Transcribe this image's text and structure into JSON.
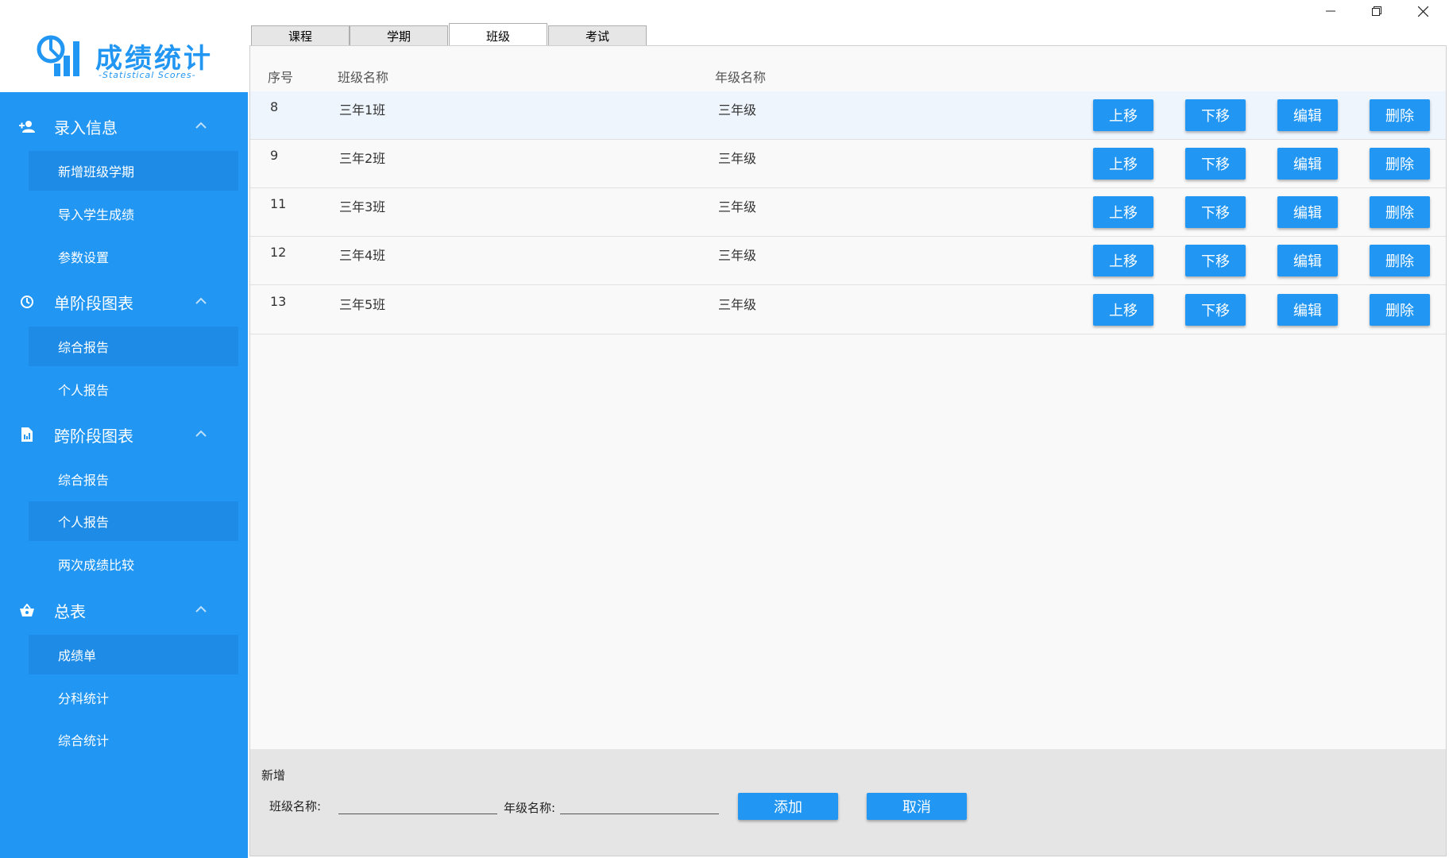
{
  "brand": {
    "title": "成绩统计",
    "subtitle": "-Statistical Scores-",
    "accent_color": "#2196f3"
  },
  "window": {
    "minimize_icon": "minimize-icon",
    "maximize_icon": "restore-icon",
    "close_icon": "close-icon"
  },
  "sidebar": {
    "sections": [
      {
        "label": "录入信息",
        "icon": "person-add-icon",
        "items": [
          "新增班级学期",
          "导入学生成绩",
          "参数设置"
        ]
      },
      {
        "label": "单阶段图表",
        "icon": "clock-icon",
        "items": [
          "综合报告",
          "个人报告"
        ]
      },
      {
        "label": "跨阶段图表",
        "icon": "document-icon",
        "items": [
          "综合报告",
          "个人报告",
          "两次成绩比较"
        ]
      },
      {
        "label": "总表",
        "icon": "basket-icon",
        "items": [
          "成绩单",
          "分科统计",
          "综合统计"
        ]
      }
    ]
  },
  "tabs": [
    "课程",
    "学期",
    "班级",
    "考试"
  ],
  "active_tab": "班级",
  "table": {
    "headers": [
      "序号",
      "班级名称",
      "年级名称"
    ],
    "rows": [
      {
        "id": "8",
        "class_name": "三年1班",
        "grade_name": "三年级"
      },
      {
        "id": "9",
        "class_name": "三年2班",
        "grade_name": "三年级"
      },
      {
        "id": "11",
        "class_name": "三年3班",
        "grade_name": "三年级"
      },
      {
        "id": "12",
        "class_name": "三年4班",
        "grade_name": "三年级"
      },
      {
        "id": "13",
        "class_name": "三年5班",
        "grade_name": "三年级"
      }
    ],
    "actions": {
      "up": "上移",
      "down": "下移",
      "edit": "编辑",
      "delete": "删除"
    }
  },
  "add_panel": {
    "title": "新增",
    "class_label": "班级名称:",
    "class_value": "",
    "grade_label": "年级名称:",
    "grade_value": "",
    "add_label": "添加",
    "cancel_label": "取消"
  }
}
